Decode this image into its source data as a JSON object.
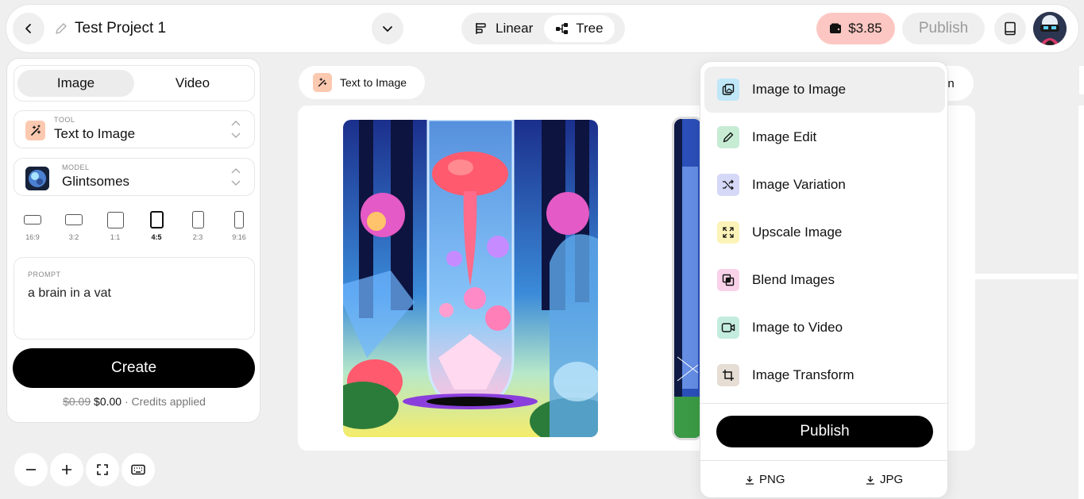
{
  "header": {
    "project_title": "Test Project 1",
    "view_options": [
      "Linear",
      "Tree"
    ],
    "active_view": "Tree",
    "credits": "$3.85",
    "publish_label": "Publish"
  },
  "left_panel": {
    "modes": [
      "Image",
      "Video"
    ],
    "active_mode": "Image",
    "tool": {
      "label": "TOOL",
      "value": "Text to Image"
    },
    "model": {
      "label": "MODEL",
      "value": "Glintsomes"
    },
    "aspect_ratios": [
      "16:9",
      "3:2",
      "1:1",
      "4:5",
      "2:3",
      "9:16"
    ],
    "active_ratio": "4:5",
    "prompt": {
      "label": "PROMPT",
      "value": "a brain in a vat"
    },
    "create_label": "Create",
    "price": {
      "original": "$0.09",
      "current": "$0.00",
      "note": "· Credits applied"
    }
  },
  "canvas": {
    "node_title": "Text to Image",
    "partial_tab_text": "in"
  },
  "menu": {
    "items": [
      {
        "label": "Image to Image",
        "icon": "image-to-image-icon",
        "color": "#bfe7f7"
      },
      {
        "label": "Image Edit",
        "icon": "pencil-icon",
        "color": "#c6ecd4"
      },
      {
        "label": "Image Variation",
        "icon": "shuffle-icon",
        "color": "#d6d8f7"
      },
      {
        "label": "Upscale Image",
        "icon": "expand-icon",
        "color": "#fbf3b8"
      },
      {
        "label": "Blend Images",
        "icon": "blend-icon",
        "color": "#f9d2ea"
      },
      {
        "label": "Image to Video",
        "icon": "video-icon",
        "color": "#c3ecdf"
      },
      {
        "label": "Image Transform",
        "icon": "crop-icon",
        "color": "#e6ddd4"
      }
    ],
    "publish_label": "Publish",
    "downloads": [
      "PNG",
      "JPG"
    ]
  },
  "colors": {
    "credit_pill": "#fcc7c2",
    "tool_icon_bg": "#fbc9b0",
    "primary": "#000000"
  }
}
